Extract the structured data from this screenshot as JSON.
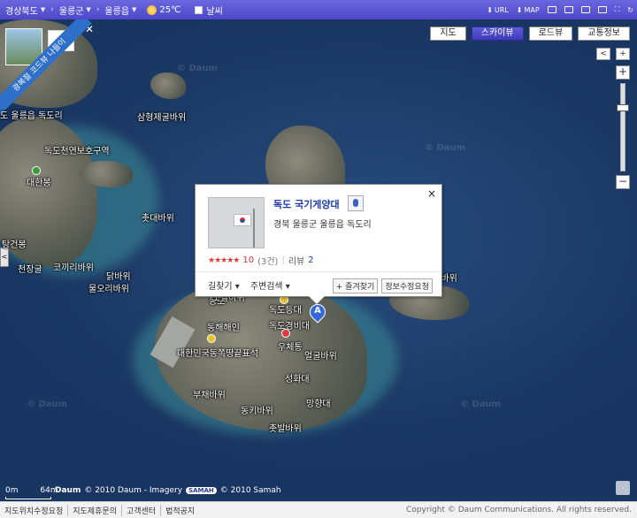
{
  "topbar": {
    "breadcrumb": [
      "경상북도",
      "울릉군",
      "울릉읍"
    ],
    "weather": "25℃",
    "weather_toggle": "날씨",
    "tools": [
      "URL",
      "MAP",
      "",
      "",
      "",
      "",
      "",
      ""
    ]
  },
  "map": {
    "ribbon_text": "광복절 코드뷰 나들이",
    "view_tabs": [
      "지도",
      "스카이뷰",
      "로드뷰",
      "교통정보"
    ],
    "active_tab": "스카이뷰",
    "nav": {
      "left": "<",
      "right": "+",
      "zoom_in": "+",
      "zoom_out": "−",
      "side": "<"
    },
    "zoom_level_fraction": 0.25,
    "labels": [
      "도 울릉읍 독도리",
      "삼형제굴바위",
      "독도천연보호구역",
      "대한봉",
      "촛대바위",
      "탕건봉",
      "천장굴",
      "코끼리바위",
      "닭바위",
      "물오리바위",
      "해녀바위",
      "동도",
      "독도경비대",
      "우체통",
      "독도등대",
      "대한민국동쪽땅끝표석",
      "얼굴바위",
      "부채바위",
      "성화대",
      "숫돌바위",
      "망향대",
      "동키바위",
      "촛발바위",
      "동해해인"
    ],
    "watermark": "© Daum",
    "scale": {
      "zero": "0m",
      "distance": "64m"
    },
    "credits": {
      "logo": "Daum",
      "imagery": "© 2010 Daum - Imagery",
      "samah_logo": "SAMAH",
      "samah": "© 2010 Samah"
    }
  },
  "popup": {
    "title": "독도 국기게양대",
    "address": "경북 울릉군 울릉읍 독도리",
    "stars": "★★★★★",
    "score": "10",
    "count": "(3건)",
    "review_label": "리뷰",
    "review_count": "2",
    "bottom_links": [
      "길찾기 ▾",
      "주변검색 ▾"
    ],
    "actions": [
      "+ 즐겨찾기",
      "정보수정요청"
    ],
    "close": "×"
  },
  "marker": {
    "label": "A"
  },
  "footer": {
    "links": [
      "지도위치수정요청",
      "지도제휴문의",
      "고객센터",
      "법적공지"
    ],
    "copyright": "Copyright © Daum Communications. All rights reserved."
  },
  "colors": {
    "topbar": "#4c48c9",
    "active_tab": "#3e3bb8",
    "sea": "#1c3a66",
    "popup_title": "#1e3aa8",
    "rating": "#e23b3b"
  }
}
